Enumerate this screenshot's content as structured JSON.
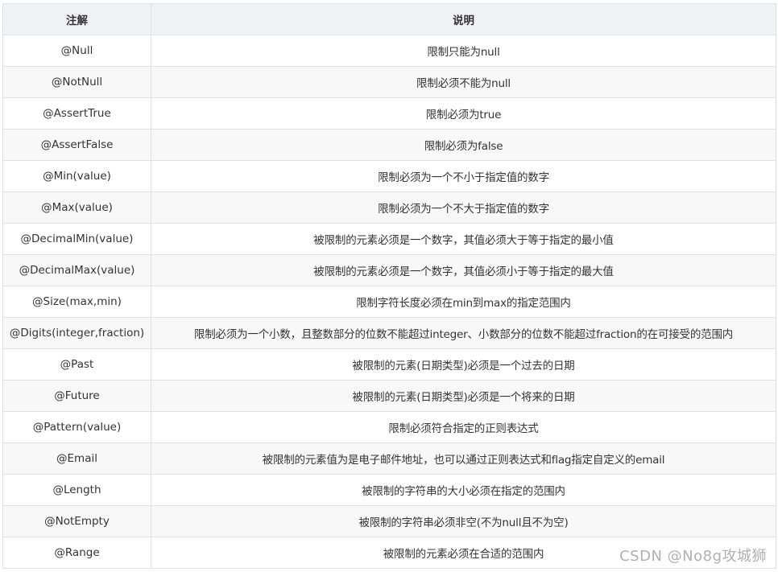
{
  "table": {
    "headers": {
      "annotation": "注解",
      "description": "说明"
    },
    "rows": [
      {
        "annotation": "@Null",
        "description": "限制只能为null"
      },
      {
        "annotation": "@NotNull",
        "description": "限制必须不能为null"
      },
      {
        "annotation": "@AssertTrue",
        "description": "限制必须为true"
      },
      {
        "annotation": "@AssertFalse",
        "description": "限制必须为false"
      },
      {
        "annotation": "@Min(value)",
        "description": "限制必须为一个不小于指定值的数字"
      },
      {
        "annotation": "@Max(value)",
        "description": "限制必须为一个不大于指定值的数字"
      },
      {
        "annotation": "@DecimalMin(value)",
        "description": "被限制的元素必须是一个数字，其值必须大于等于指定的最小值"
      },
      {
        "annotation": "@DecimalMax(value)",
        "description": "被限制的元素必须是一个数字，其值必须小于等于指定的最大值"
      },
      {
        "annotation": "@Size(max,min)",
        "description": "限制字符长度必须在min到max的指定范围内"
      },
      {
        "annotation": "@Digits(integer,fraction)",
        "description": "限制必须为一个小数，且整数部分的位数不能超过integer、小数部分的位数不能超过fraction的在可接受的范围内"
      },
      {
        "annotation": "@Past",
        "description": "被限制的元素(日期类型)必须是一个过去的日期"
      },
      {
        "annotation": "@Future",
        "description": "被限制的元素(日期类型)必须是一个将来的日期"
      },
      {
        "annotation": "@Pattern(value)",
        "description": "限制必须符合指定的正则表达式"
      },
      {
        "annotation": "@Email",
        "description": "被限制的元素值为是电子邮件地址，也可以通过正则表达式和flag指定自定义的email"
      },
      {
        "annotation": "@Length",
        "description": "被限制的字符串的大小必须在指定的范围内"
      },
      {
        "annotation": "@NotEmpty",
        "description": "被限制的字符串必须非空(不为null且不为空)"
      },
      {
        "annotation": "@Range",
        "description": "被限制的元素必须在合适的范围内"
      }
    ]
  },
  "watermark": "CSDN @No8g攻城狮",
  "colors": {
    "header_bg": "#eff3f5",
    "row_alt_bg": "#f8f8f8",
    "border": "#dfe2e5",
    "text": "#333333"
  }
}
